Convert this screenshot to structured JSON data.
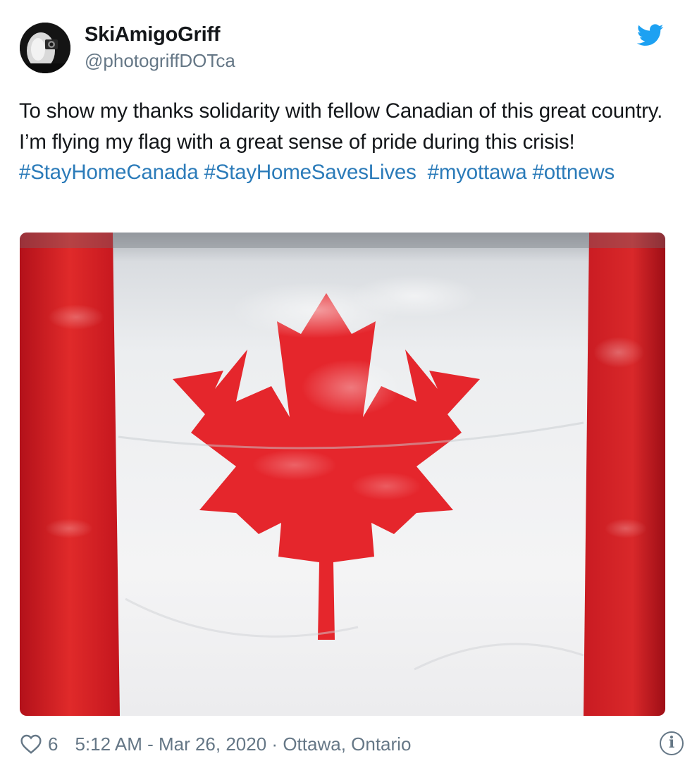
{
  "author": {
    "display_name": "SkiAmigoGriff",
    "handle": "@photogriffDOTca",
    "avatar_icon": "avatar-photo"
  },
  "brand": {
    "icon": "twitter-bird-icon",
    "color": "#1da1f2"
  },
  "tweet": {
    "text_plain": "To show my thanks solidarity with fellow Canadian of this great country. I’m flying my flag with a great sense of pride during this crisis!",
    "hashtags": [
      "#StayHomeCanada",
      "#StayHomeSavesLives",
      "#myottawa",
      "#ottnews"
    ],
    "hashtag_color": "#2b7bb9"
  },
  "media": {
    "icon": "canadian-flag-photo"
  },
  "footer": {
    "like_icon": "heart-icon",
    "like_count": "6",
    "timestamp": "5:12 AM - Mar 26, 2020",
    "separator": "·",
    "location": "Ottawa, Ontario",
    "info_icon": "info-icon",
    "info_label": "i"
  }
}
